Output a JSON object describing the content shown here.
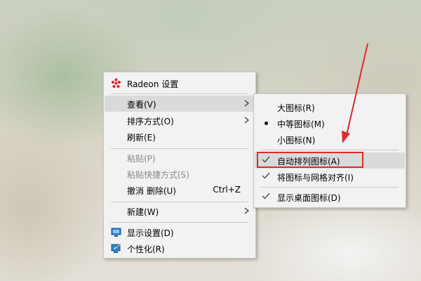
{
  "context_menu": {
    "radeon": "Radeon 设置",
    "view": "查看(V)",
    "sort": "排序方式(O)",
    "refresh": "刷新(E)",
    "paste": "粘贴(P)",
    "paste_shortcut": "粘贴快捷方式(S)",
    "undo_delete": "撤消 删除(U)",
    "undo_shortcut": "Ctrl+Z",
    "new": "新建(W)",
    "display_settings": "显示设置(D)",
    "personalize": "个性化(R)"
  },
  "view_submenu": {
    "large_icons": "大图标(R)",
    "medium_icons": "中等图标(M)",
    "small_icons": "小图标(N)",
    "auto_arrange": "自动排列图标(A)",
    "align_grid": "将图标与网格对齐(I)",
    "show_desktop_icons": "显示桌面图标(D)"
  },
  "colors": {
    "annotation_red": "#e02a2a",
    "radeon_red": "#d7282f"
  },
  "icons": [
    "radeon-logo-icon",
    "chevron-right-icon",
    "check-icon",
    "bullet-icon",
    "monitor-icon",
    "personalize-icon"
  ]
}
